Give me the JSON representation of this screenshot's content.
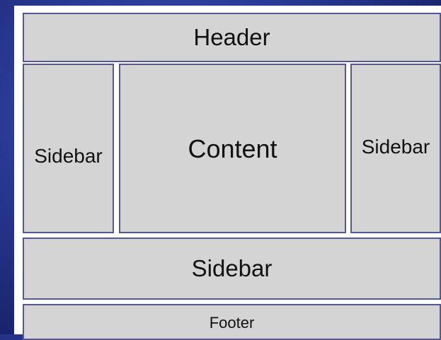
{
  "diagram": {
    "header": "Header",
    "left_sidebar": "Sidebar",
    "content": "Content",
    "right_sidebar": "Sidebar",
    "wide_sidebar": "Sidebar",
    "footer": "Footer"
  },
  "colors": {
    "background": "#2a3a96",
    "panel_fill": "#d4d4d4",
    "panel_border": "#55598f",
    "canvas": "#ffffff",
    "text": "#111111"
  }
}
